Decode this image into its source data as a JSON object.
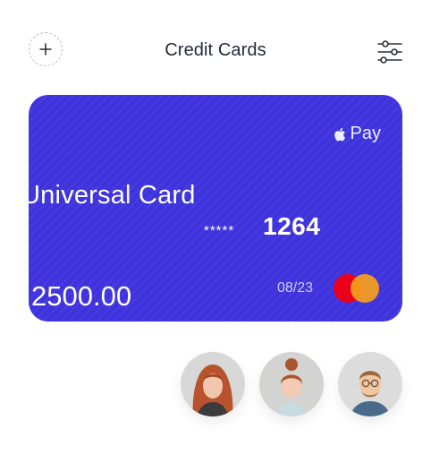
{
  "header": {
    "title": "Credit Cards",
    "add_icon": "plus-icon",
    "filter_icon": "sliders-icon"
  },
  "card": {
    "wallet_label": "Pay",
    "wallet_icon": "apple-icon",
    "name": "Universal Card",
    "masked_digits": "*****",
    "last4": "1264",
    "balance": "2500.00",
    "expiry": "08/23",
    "network_icon": "mastercard-logo",
    "color": "#3f33dd"
  },
  "contacts": [
    {
      "id": "contact-1",
      "hair": "#b8532e"
    },
    {
      "id": "contact-2",
      "hair": "#a8542f"
    },
    {
      "id": "contact-3",
      "hair": "#9a6a3a"
    }
  ]
}
